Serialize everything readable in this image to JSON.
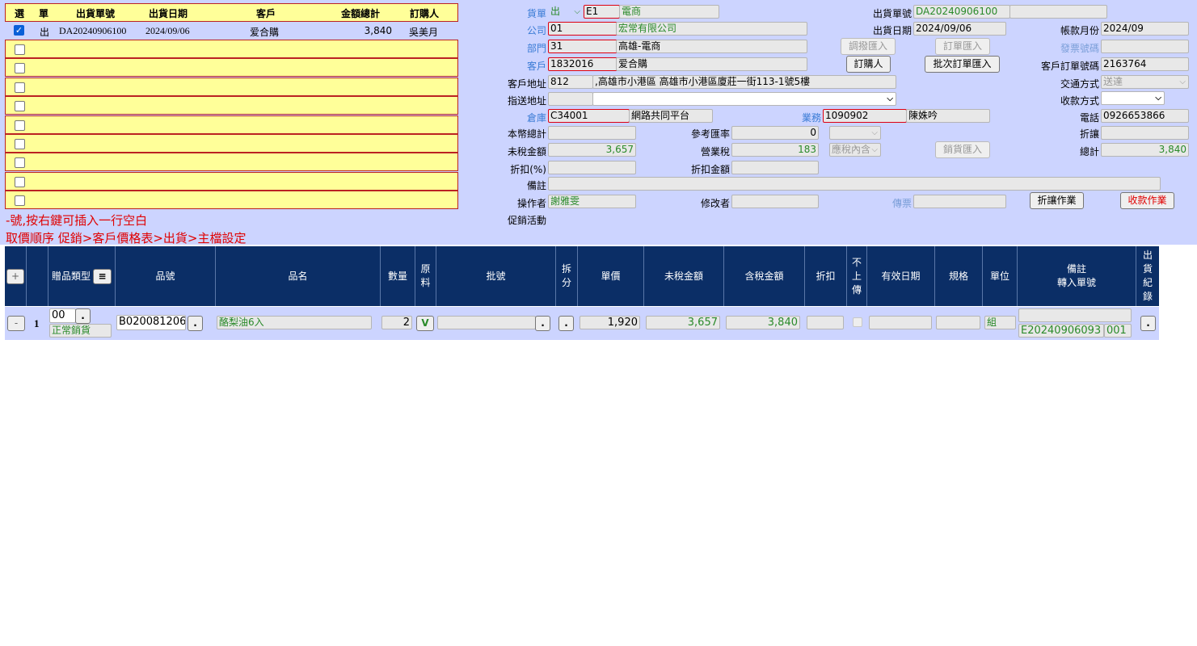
{
  "list": {
    "headers": [
      "選",
      "單",
      "出貨單號",
      "出貨日期",
      "客戶",
      "金額總計",
      "訂購人"
    ],
    "row": {
      "type": "出",
      "order_no": "DA20240906100",
      "date": "2024/09/06",
      "customer": "爱合購",
      "amount": "3,840",
      "buyer": "吳美月"
    },
    "note1": "-號,按右鍵可插入一行空白",
    "note2": "取價順序 促銷>客戶價格表>出貨>主檔設定"
  },
  "form": {
    "doc_label": "貨單",
    "doc_type": "出",
    "doc_code": "E1",
    "doc_code_name": "電商",
    "ship_no_label": "出貨單號",
    "ship_no": "DA20240906100",
    "company_label": "公司",
    "company_code": "01",
    "company_name": "宏常有限公司",
    "ship_date_label": "出貨日期",
    "ship_date": "2024/09/06",
    "account_month_label": "帳款月份",
    "account_month": "2024/09",
    "dept_label": "部門",
    "dept_code": "31",
    "dept_name": "高雄-電商",
    "btn_transfer": "調撥匯入",
    "btn_order_import": "訂單匯入",
    "invoice_label": "發票號碼",
    "customer_label": "客戶",
    "customer_code": "1832016",
    "customer_name": "爱合購",
    "btn_buyer": "訂購人",
    "btn_batch_order": "批次訂單匯入",
    "cust_order_label": "客戶訂單號碼",
    "cust_order_no": "2163764",
    "cust_addr_label": "客戶地址",
    "cust_zip": "812",
    "cust_addr": ",高雄市小港區 高雄市小港區廈莊一街113-1號5樓",
    "transport_label": "交通方式",
    "transport": "送達",
    "deliver_addr_label": "指送地址",
    "payment_label": "收款方式",
    "warehouse_label": "倉庫",
    "warehouse_code": "C34001",
    "warehouse_name": "網路共同平台",
    "sales_label": "業務",
    "sales_code": "1090902",
    "sales_name": "陳姝吟",
    "phone_label": "電話",
    "phone": "0926653866",
    "local_total_label": "本幣總計",
    "ref_rate_label": "參考匯率",
    "ref_rate": "0",
    "discount_label": "折讓",
    "pretax_label": "未稅金額",
    "pretax": "3,657",
    "tax_label": "營業稅",
    "tax": "183",
    "tax_type": "應稅內含",
    "btn_sales_import": "銷貨匯入",
    "total_label": "總計",
    "total": "3,840",
    "discount_pct_label": "折扣(%)",
    "discount_amt_label": "折扣金額",
    "remark_label": "備註",
    "operator_label": "操作者",
    "operator": "謝雅雯",
    "modifier_label": "修改者",
    "voucher_label": "傳票",
    "btn_discount": "折讓作業",
    "btn_collect": "收款作業",
    "promo_label": "促銷活動"
  },
  "grid": {
    "headers": {
      "add": "+",
      "gift_type": "贈品類型",
      "gift_btn": "≡",
      "item_no": "品號",
      "item_name": "品名",
      "qty": "數量",
      "raw_material": "原料",
      "batch": "批號",
      "split": "拆分",
      "unit_price": "單價",
      "pretax_amt": "未稅金額",
      "tax_amt": "含稅金額",
      "discount": "折扣",
      "no_upload": "不上傳",
      "expiry": "有效日期",
      "spec": "規格",
      "unit": "單位",
      "remark": "備註",
      "transfer_no": "轉入單號",
      "ship_record": "出貨紀錄"
    },
    "row": {
      "minus": "-",
      "seq": "1",
      "gift_code": "00",
      "gift_name": "正常銷貨",
      "item_no": "B020081206",
      "item_name": "酪梨油6入",
      "qty": "2",
      "raw_flag": "V",
      "unit_price": "1,920",
      "pretax_amt": "3,657",
      "tax_amt": "3,840",
      "unit": "組",
      "transfer_no": "E20240906093",
      "transfer_seq": "001"
    }
  }
}
